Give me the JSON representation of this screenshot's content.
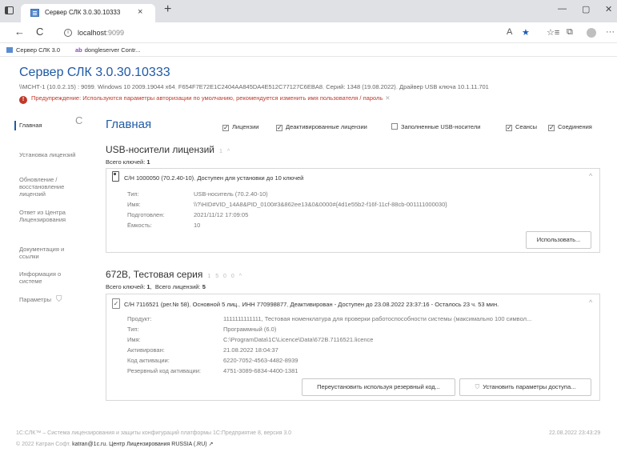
{
  "browser": {
    "tab_title": "Сервер СЛК 3.0.30.10333",
    "tab_close": "×",
    "new_tab": "+",
    "minimize": "—",
    "restore": "▢",
    "close": "✕",
    "back": "←",
    "reload": "C",
    "info": "i",
    "url_host": "localhost",
    "url_port": ":9099",
    "read_aloud": "A",
    "star": "★",
    "favorites": "☆≡",
    "collections": "⧉",
    "more": "···",
    "bookmarks": [
      {
        "label": "Сервер СЛК 3.0"
      },
      {
        "prefix": "ab",
        "label": "dongleserver Contr..."
      }
    ]
  },
  "server": {
    "title": "Сервер СЛК 3.0.30.10333",
    "info": [
      "\\\\МСНТ-1 (10.0.2.15) : 9099",
      "Windows 10 2009.19044 x64",
      "F654F7E72E1C2404AA845DA4E512C77127C6EBA8",
      "Серий: 1348 (19.08.2022)",
      "Драйвер USB ключа 10.1.11.701"
    ],
    "warning": "Предупреждение: Используются параметры авторизации по умолчанию, рекомендуется изменить имя пользователя / пароль",
    "warning_close": "✕"
  },
  "sidebar": {
    "items": [
      {
        "label": "Главная"
      },
      {
        "label": "Установка лицензий"
      },
      {
        "label": "Обновление / восстановление лицензий"
      },
      {
        "label": "Ответ из Центра Лицензирования"
      },
      {
        "label": "Документация и ссылки"
      },
      {
        "label": "Информация о системе"
      },
      {
        "label": "Параметры"
      }
    ],
    "refresh": "C"
  },
  "main": {
    "title": "Главная",
    "filters": [
      {
        "label": "Лицензии",
        "checked": true
      },
      {
        "label": "Деактивированные лицензии",
        "checked": true
      },
      {
        "label": "Заполненные USB-носители",
        "checked": false
      },
      {
        "label": "Сеансы",
        "checked": true
      },
      {
        "label": "Соединения",
        "checked": true
      }
    ]
  },
  "usb_section": {
    "title": "USB-носители лицензий",
    "badges": "1 ^",
    "count_label": "Всего ключей:",
    "count": "1",
    "card": {
      "head": "С/Н 1000050 (70.2.40-10)",
      "status": "Доступен для установки до 10 ключей",
      "fields": [
        {
          "label": "Тип:",
          "value": "USB-носитель (70.2.40-10)"
        },
        {
          "label": "Имя:",
          "value": "\\\\?\\HID#VID_14A8&PID_0100#3&862ee13&0&0000#{4d1e55b2-f16f-11cf-88cb-001111000030}"
        },
        {
          "label": "Подготовлен:",
          "value": "2021/11/12 17:09:05"
        },
        {
          "label": "Ёмкость:",
          "value": "10"
        }
      ],
      "button": "Использовать..."
    }
  },
  "lic_section": {
    "title": "672B, Тестовая серия",
    "badges": "1 5 0 0 ^",
    "count_label": "Всего ключей:",
    "count": "1",
    "lic_label": "Всего лицензий:",
    "lic_count": "5",
    "card": {
      "head": "С/Н 7116521 (рег.№ 58)",
      "base": "Основной 5 лиц.",
      "inn": "ИНН 770998877",
      "status": "Деактивирован - Доступен до 23.08.2022 23:37:16 - Осталось 23 ч. 53 мин.",
      "fields": [
        {
          "label": "Продукт:",
          "value": "1111111111111, Тестовая номенклатура для проверки работоспособности системы (максимально 100 символ..."
        },
        {
          "label": "Тип:",
          "value": "Программный (6.0)"
        },
        {
          "label": "Имя:",
          "value": "C:\\ProgramData\\1C\\Licence\\Data\\672B.7116521.licence"
        },
        {
          "label": "Активирован:",
          "value": "21.08.2022 18:04:37"
        },
        {
          "label": "Код активации:",
          "value": "6220-7052-4563-4482-8939"
        },
        {
          "label": "Резервный код активации:",
          "value": "4751-3089-6834-4400-1381"
        }
      ],
      "button_reinstall": "Переустановить используя резервный код...",
      "button_access": "Установить параметры доступа..."
    }
  },
  "footer": {
    "line1": "1С:СЛК™ – Система лицензирования и защиты конфигураций платформы 1С:Предприятие 8, версия 3.0",
    "line2_prefix": "© 2022 Катран Софт.",
    "email": "katran@1c.ru.",
    "center": "Центр Лицензирования RUSSIA (.RU)",
    "date": "22.08.2022 23:43:29"
  }
}
